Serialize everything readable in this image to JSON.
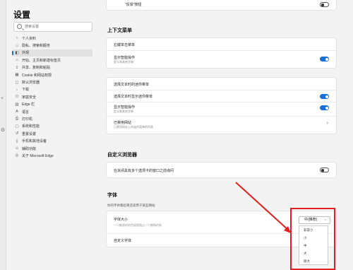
{
  "sidebar": {
    "title": "设置",
    "search_placeholder": "搜索设置",
    "items": [
      {
        "label": "个人资料",
        "icon": "person-icon"
      },
      {
        "label": "隐私、搜索和服务",
        "icon": "lock-icon"
      },
      {
        "label": "外观",
        "icon": "appearance-icon"
      },
      {
        "label": "开始、主页和新建标签页",
        "icon": "home-icon"
      },
      {
        "label": "共享、复制和粘贴",
        "icon": "share-icon"
      },
      {
        "label": "Cookie 和网站权限",
        "icon": "cookie-icon"
      },
      {
        "label": "默认浏览器",
        "icon": "browser-icon"
      },
      {
        "label": "下载",
        "icon": "download-icon"
      },
      {
        "label": "家庭安全",
        "icon": "family-icon"
      },
      {
        "label": "Edge 栏",
        "icon": "edge-bar-icon"
      },
      {
        "label": "语言",
        "icon": "language-icon"
      },
      {
        "label": "打印机",
        "icon": "printer-icon"
      },
      {
        "label": "系统和性能",
        "icon": "system-icon"
      },
      {
        "label": "重置设置",
        "icon": "reset-icon"
      },
      {
        "label": "手机和其他设备",
        "icon": "phone-icon"
      },
      {
        "label": "辅助功能",
        "icon": "accessibility-icon"
      },
      {
        "label": "关于 Microsoft Edge",
        "icon": "edge-icon"
      }
    ],
    "active_index": 2
  },
  "main": {
    "top_partial_row": "\"反馈\"按钮",
    "context_menu": {
      "title": "上下文菜单",
      "card1": {
        "header": "右键单击菜单",
        "row_title": "显示智能操作",
        "row_sub": "定义和其他字典",
        "toggle_on": true
      },
      "card2": {
        "header": "选择文本时的迷你菜单",
        "row1": "选择文本时显示迷你菜单",
        "row1_on": true,
        "row2_title": "显示智能操作",
        "row2_sub": "定义和其他字典",
        "row2_on": true,
        "row3_title": "已禁用网站",
        "row3_sub": "已禁用网站上的迷你菜单的列表"
      }
    },
    "custom_browser": {
      "title": "自定义浏览器",
      "row": "在关闭具有多个选项卡的窗口之前询问",
      "toggle_on": false
    },
    "fonts": {
      "title": "字体",
      "subtitle": "你的字体看起来还适用于某些网站",
      "size_label": "字体大小",
      "preview_text": "一只敏捷的棕色狐狸跳过一只懒惰的狗",
      "custom_label": "自定义字体",
      "dropdown_value": "中(推荐)",
      "options": [
        "非常小",
        "小",
        "中",
        "大",
        "很大"
      ]
    }
  },
  "colors": {
    "accent": "#1a6fd3",
    "highlight": "#e02020"
  }
}
